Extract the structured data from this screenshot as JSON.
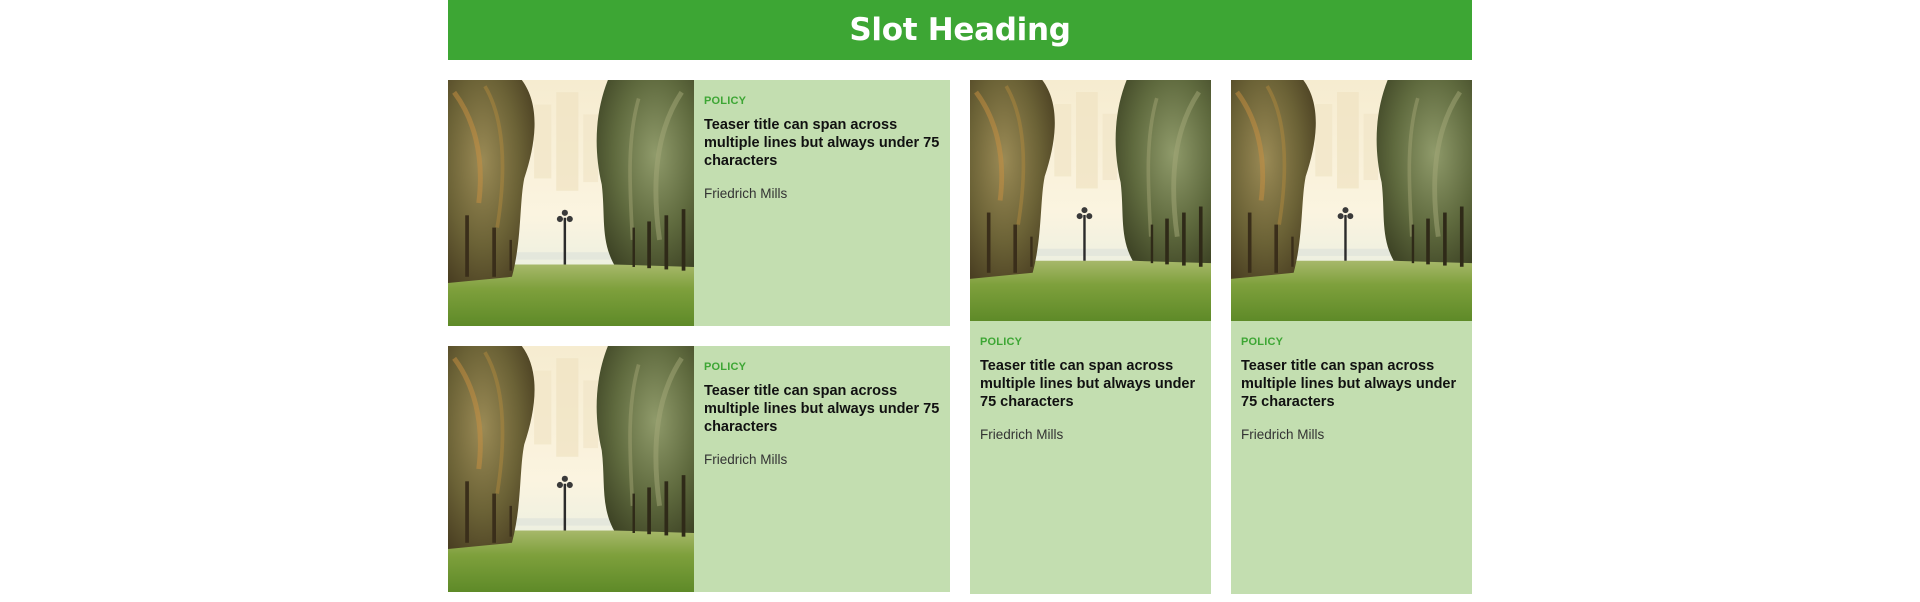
{
  "slot": {
    "heading": "Slot Heading",
    "accent_color": "#3da634",
    "card_background": "#c3deb0"
  },
  "cards": [
    {
      "category": "POLICY",
      "title": "Teaser title can span across multiple lines but always under 75 characters",
      "author": "Friedrich Mills",
      "image": "park-palm-trees-image"
    },
    {
      "category": "POLICY",
      "title": "Teaser title can span across multiple lines but always under 75 characters",
      "author": "Friedrich Mills",
      "image": "park-palm-trees-image"
    },
    {
      "category": "POLICY",
      "title": "Teaser title can span across multiple lines but always under 75 characters",
      "author": "Friedrich Mills",
      "image": "park-palm-trees-image"
    },
    {
      "category": "POLICY",
      "title": "Teaser title can span across multiple lines but always under 75 characters",
      "author": "Friedrich Mills",
      "image": "park-palm-trees-image"
    }
  ]
}
